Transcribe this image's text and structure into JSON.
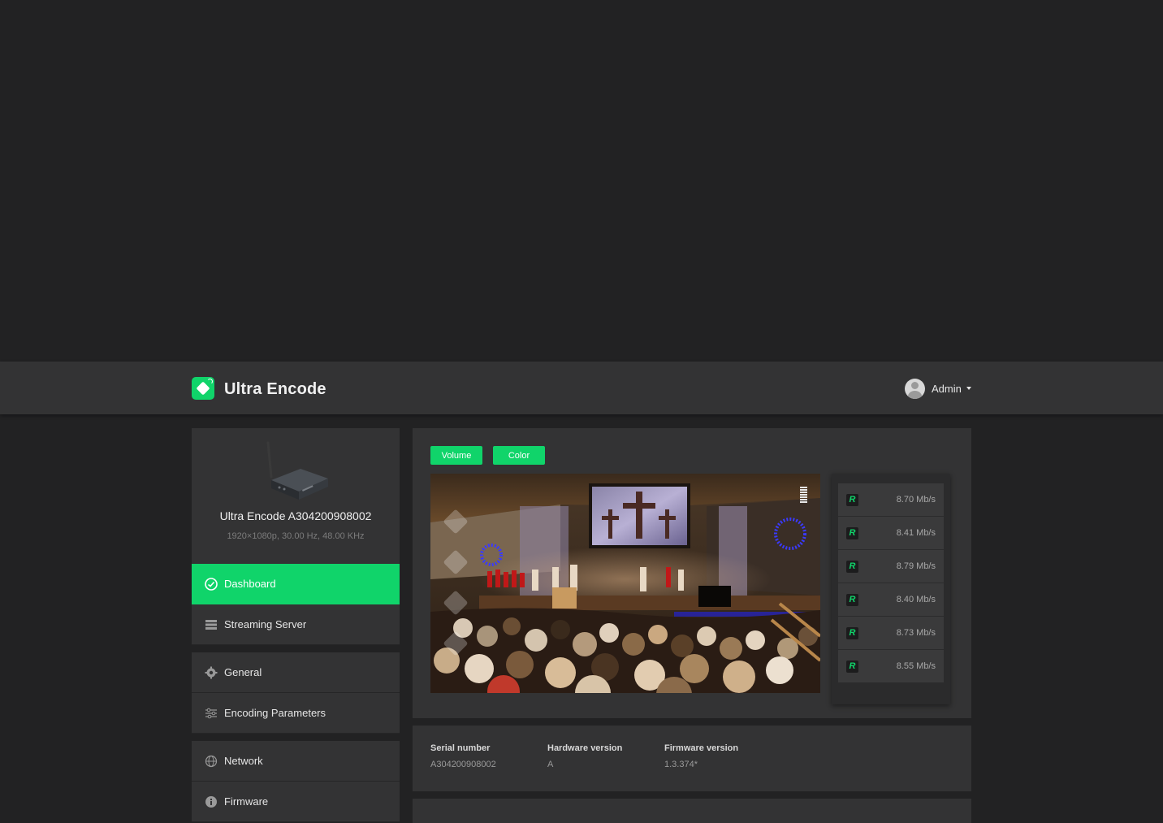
{
  "header": {
    "app_title": "Ultra Encode",
    "user_name": "Admin"
  },
  "device": {
    "name": "Ultra Encode A304200908002",
    "spec": "1920×1080p, 30.00 Hz, 48.00 KHz"
  },
  "sidebar": {
    "items": [
      {
        "label": "Dashboard",
        "icon": "dashboard-icon",
        "active": true
      },
      {
        "label": "Streaming Server",
        "icon": "server-icon"
      },
      {
        "label": "General",
        "icon": "gear-icon"
      },
      {
        "label": "Encoding Parameters",
        "icon": "sliders-icon"
      },
      {
        "label": "Network",
        "icon": "globe-icon"
      },
      {
        "label": "Firmware",
        "icon": "info-icon"
      }
    ]
  },
  "preview": {
    "volume_label": "Volume",
    "color_label": "Color"
  },
  "streams": [
    {
      "badge": "R",
      "rate": "8.70 Mb/s"
    },
    {
      "badge": "R",
      "rate": "8.41 Mb/s"
    },
    {
      "badge": "R",
      "rate": "8.79 Mb/s"
    },
    {
      "badge": "R",
      "rate": "8.40 Mb/s"
    },
    {
      "badge": "R",
      "rate": "8.73 Mb/s"
    },
    {
      "badge": "R",
      "rate": "8.55 Mb/s"
    }
  ],
  "info": {
    "serial_label": "Serial number",
    "serial_value": "A304200908002",
    "hardware_label": "Hardware version",
    "hardware_value": "A",
    "firmware_label": "Firmware version",
    "firmware_value": "1.3.374*"
  },
  "colors": {
    "accent": "#10d46a",
    "card": "#333334",
    "background": "#222223"
  }
}
